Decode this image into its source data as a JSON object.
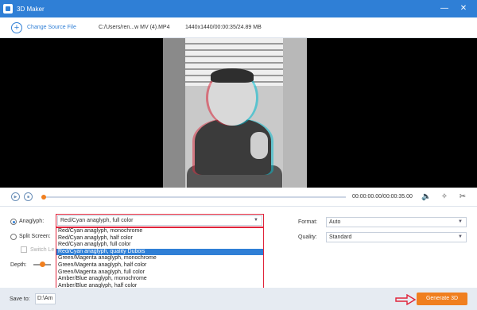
{
  "window": {
    "title": "3D Maker",
    "minimize_glyph": "—",
    "close_glyph": "✕"
  },
  "toolbar": {
    "change_source_label": "Change Source File",
    "file_path": "C:/Users/ren...w MV (4).MP4",
    "file_info": "1440x1440/00:00:35/24.89 MB"
  },
  "playback": {
    "play_glyph": "▶",
    "stop_glyph": "■",
    "progress": 0.0,
    "timecode": "00:00:00.00/00:00:35.00",
    "volume_icon": "volume-icon",
    "pin_icon": "pin-icon",
    "cut_icon": "scissors-icon"
  },
  "settings": {
    "anaglyph_label": "Anaglyph:",
    "anaglyph_selected": "Red/Cyan anaglyph, full color",
    "anaglyph_options": [
      "Red/Cyan anaglyph, monochrome",
      "Red/Cyan anaglyph, half color",
      "Red/Cyan anaglyph, full color",
      "Red/Cyan anaglyph, quality Dubois",
      "Green/Magenta anaglyph, monochrome",
      "Green/Magenta anaglyph, half color",
      "Green/Magenta anaglyph, full color",
      "Amber/Blue anaglyph, monochrome",
      "Amber/Blue anaglyph, half color",
      "Amber/Blue anaglyph, full color"
    ],
    "highlighted_option_index": 3,
    "split_screen_label": "Split Screen:",
    "switch_label": "Switch Le",
    "depth_label": "Depth:",
    "format_label": "Format:",
    "format_value": "Auto",
    "quality_label": "Quality:",
    "quality_value": "Standard",
    "dropdown_arrow": "▼"
  },
  "footer": {
    "save_to_label": "Save to:",
    "save_path": "D:\\Am",
    "generate_label": "Generate 3D"
  },
  "colors": {
    "accent": "#2f7fd6",
    "button": "#f07f1f",
    "highlight_border": "#e0243b"
  }
}
